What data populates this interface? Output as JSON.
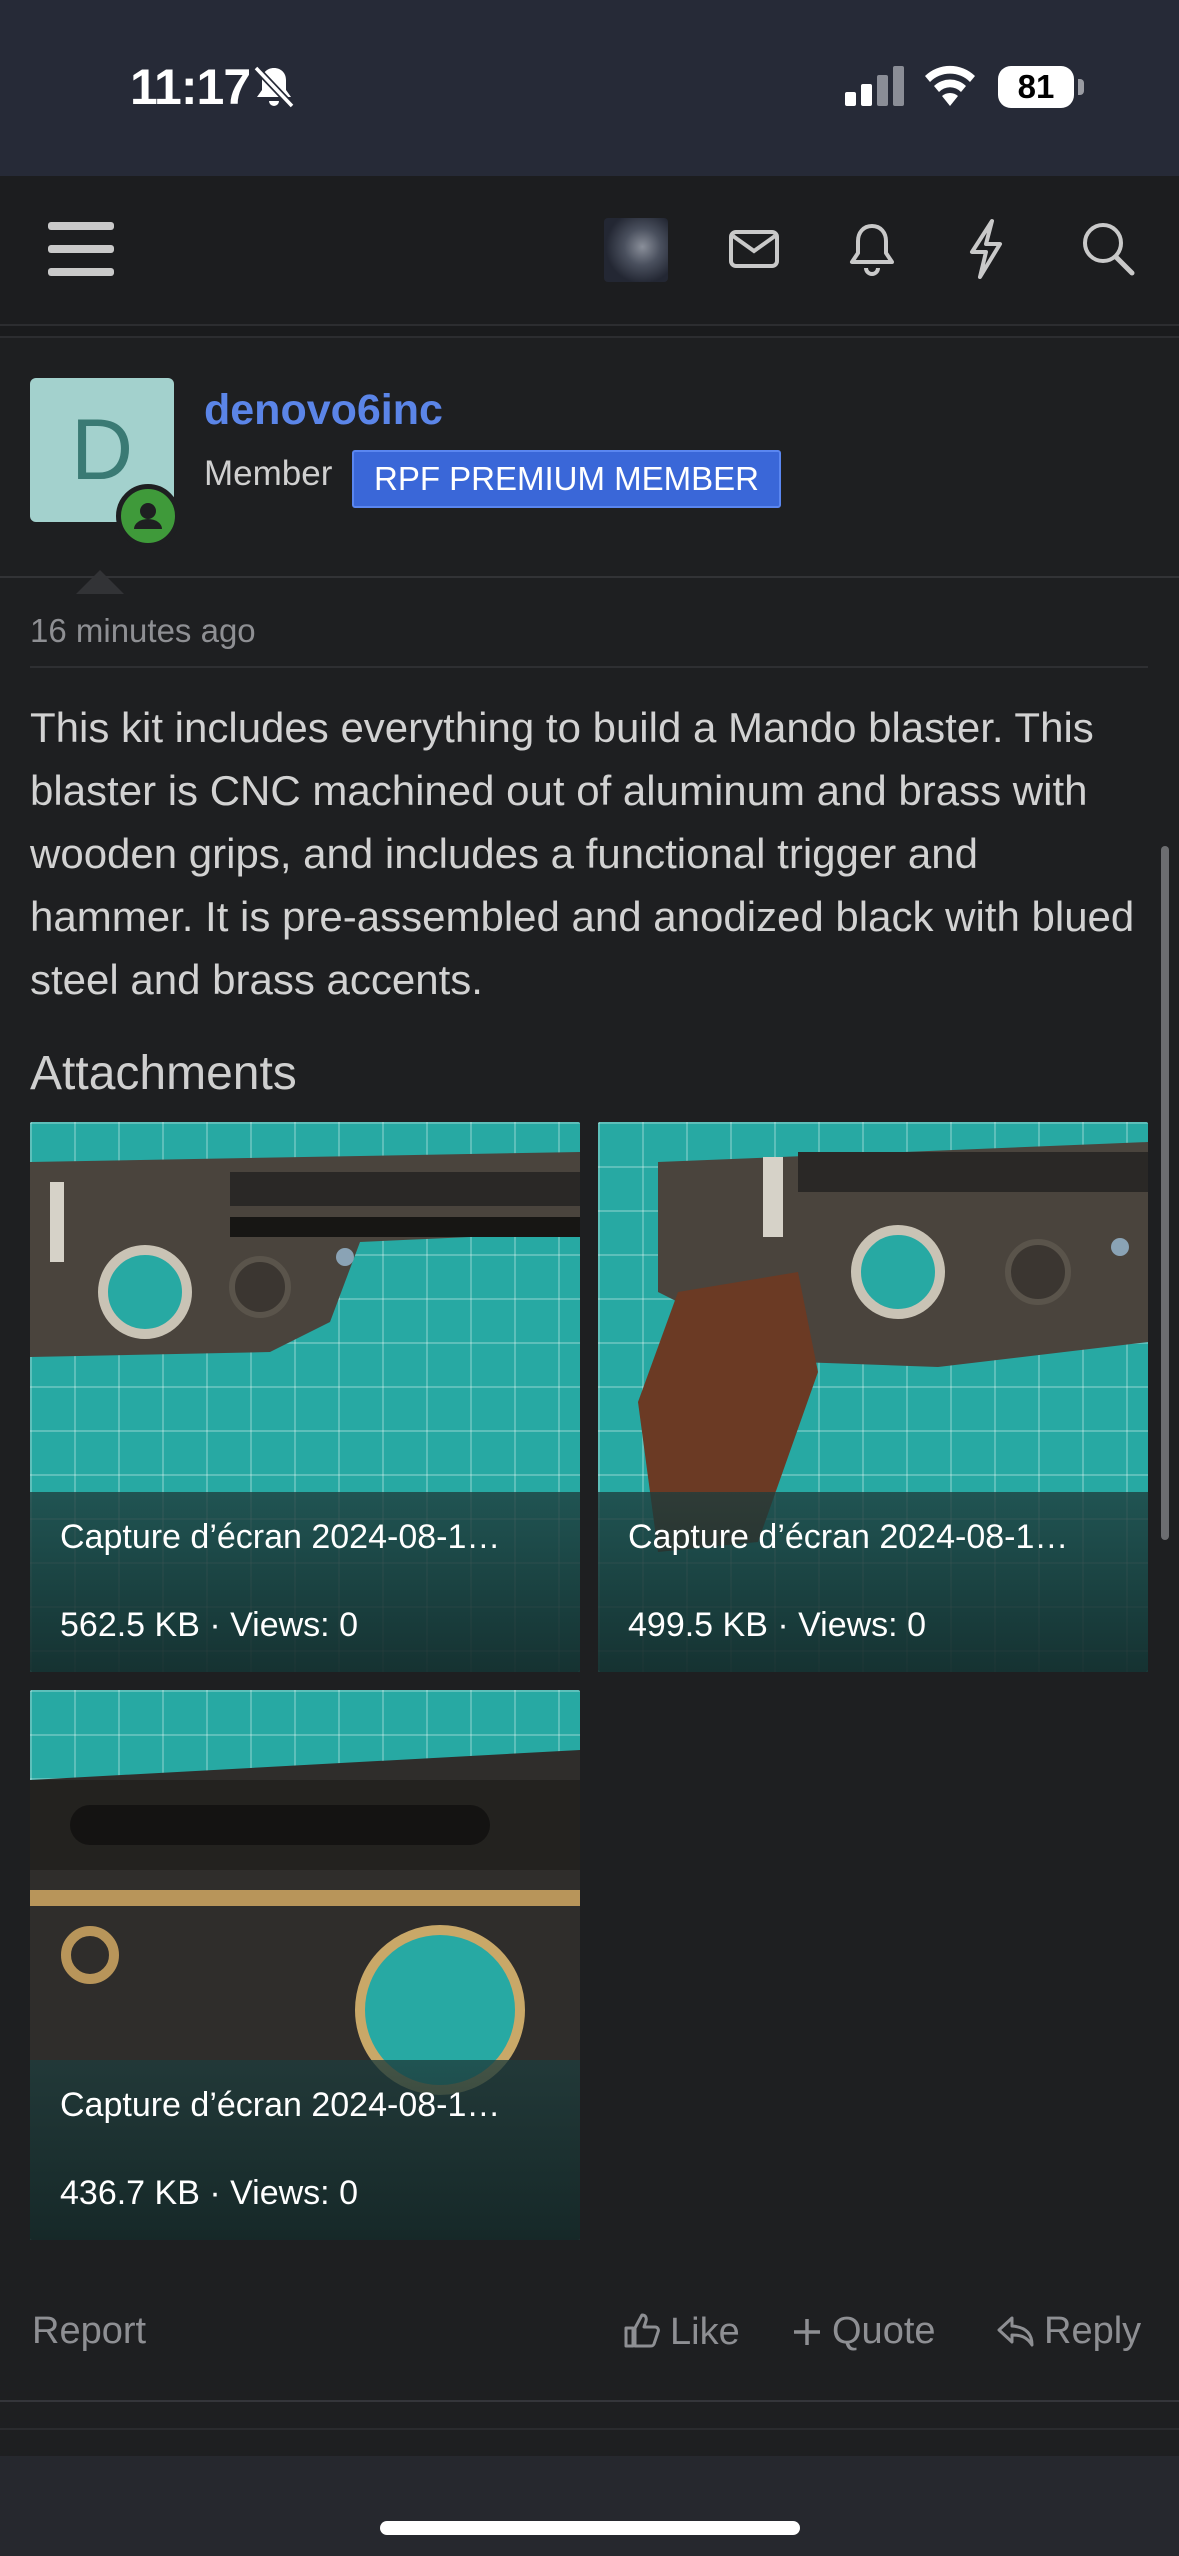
{
  "status_bar": {
    "time": "11:17",
    "battery": "81"
  },
  "nav": {
    "icons": [
      "menu-icon",
      "avatar",
      "mail-icon",
      "bell-icon",
      "bolt-icon",
      "search-icon"
    ]
  },
  "post": {
    "avatar_letter": "D",
    "username": "denovo6inc",
    "role": "Member",
    "badge": "RPF PREMIUM MEMBER",
    "timestamp": "16 minutes ago",
    "body": "This kit includes everything to build a Mando blaster. This blaster is CNC machined out of aluminum and brass with wooden grips, and includes a functional trigger and hammer. It is pre-assembled and anodized black with blued steel and brass accents.",
    "attachments_title": "Attachments",
    "attachments": [
      {
        "filename": "Capture d’écran 2024-08-1…",
        "meta": "562.5 KB · Views: 0"
      },
      {
        "filename": "Capture d’écran 2024-08-1…",
        "meta": "499.5 KB · Views: 0"
      },
      {
        "filename": "Capture d’écran 2024-08-1…",
        "meta": "436.7 KB · Views: 0"
      }
    ],
    "actions": {
      "report": "Report",
      "like": "Like",
      "quote": "Quote",
      "reply": "Reply"
    }
  },
  "colors": {
    "accent": "#5b85e8",
    "badge": "#3a67d8",
    "background": "#1e1f21"
  }
}
